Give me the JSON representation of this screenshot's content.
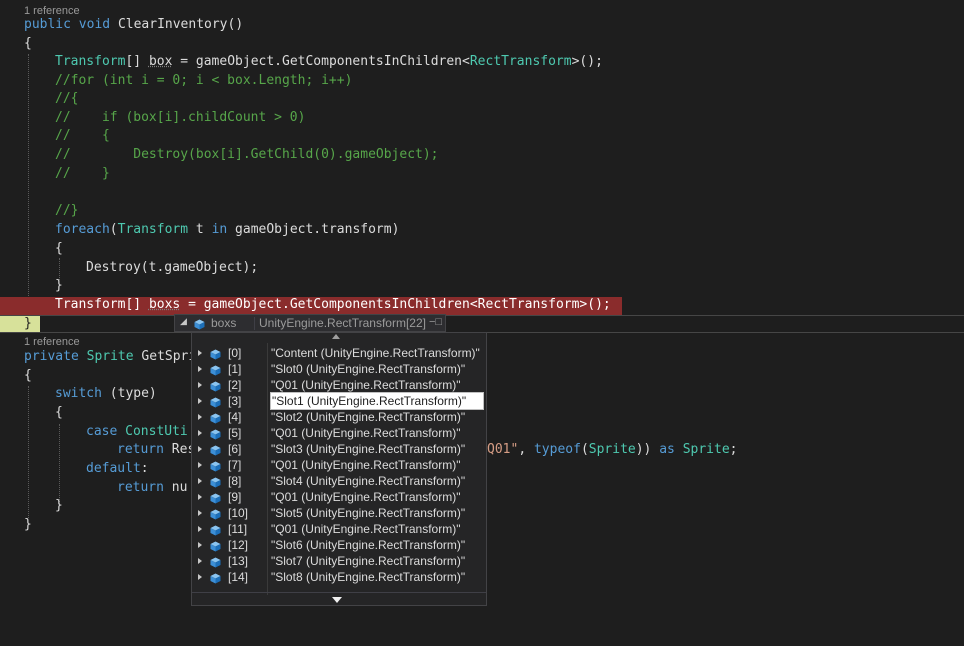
{
  "code": {
    "ref1": "1 reference",
    "ref2": "1 reference",
    "l1": {
      "kw1": "public",
      "kw2": "void",
      "name": "ClearInventory()"
    },
    "l2": "{",
    "l3": {
      "ty1": "Transform",
      "p1": "[] ",
      "box": "box",
      "p2": " = gameObject.GetComponentsInChildren<",
      "ty2": "RectTransform",
      "p3": ">();"
    },
    "l4": "//for (int i = 0; i < box.Length; i++)",
    "l5": "//{",
    "l6": "//    if (box[i].childCount > 0)",
    "l7": "//    {",
    "l8": "//        Destroy(box[i].GetChild(0).gameObject);",
    "l9": "//    }",
    "l10": "//}",
    "l11": {
      "kw1": "foreach",
      "p1": "(",
      "ty1": "Transform",
      "p2": " t ",
      "kw2": "in",
      "p3": " gameObject.transform)"
    },
    "l12": "{",
    "l13": "Destroy(t.gameObject);",
    "l14": "}",
    "l15": {
      "ty1": "Transform",
      "p1": "[] ",
      "boxs": "boxs",
      "p2": " = gameObject.GetComponentsInChildren<",
      "ty2": "RectTransform",
      "p3": ">();"
    },
    "l16": "}",
    "l17": {
      "kw1": "private",
      "ty1": "Sprite",
      "name": "GetSpri"
    },
    "l18": "{",
    "l19": {
      "kw1": "switch",
      "p1": " (type)"
    },
    "l20": "{",
    "l21": {
      "kw1": "case",
      "p1": "ConstUti"
    },
    "l22": {
      "kw1": "return",
      "p1": "Res",
      "st1": "Q01\"",
      "p2": ", ",
      "kw2": "typeof",
      "p3": "(",
      "ty1": "Sprite",
      "p4": ")) ",
      "kw3": "as",
      "p5": " ",
      "ty2": "Sprite",
      "p6": ";"
    },
    "l23": {
      "kw1": "default",
      "p1": ":"
    },
    "l24": {
      "kw1": "return",
      "p1": "nu"
    },
    "l25": "}",
    "l26": "}"
  },
  "datatip": {
    "name": "boxs",
    "value": "UnityEngine.RectTransform[22]",
    "rows": [
      {
        "index": "[0]",
        "value": "\"Content (UnityEngine.RectTransform)\""
      },
      {
        "index": "[1]",
        "value": "\"Slot0 (UnityEngine.RectTransform)\""
      },
      {
        "index": "[2]",
        "value": "\"Q01 (UnityEngine.RectTransform)\""
      },
      {
        "index": "[3]",
        "value": "\"Slot1 (UnityEngine.RectTransform)\""
      },
      {
        "index": "[4]",
        "value": "\"Slot2 (UnityEngine.RectTransform)\""
      },
      {
        "index": "[5]",
        "value": "\"Q01 (UnityEngine.RectTransform)\""
      },
      {
        "index": "[6]",
        "value": "\"Slot3 (UnityEngine.RectTransform)\""
      },
      {
        "index": "[7]",
        "value": "\"Q01 (UnityEngine.RectTransform)\""
      },
      {
        "index": "[8]",
        "value": "\"Slot4 (UnityEngine.RectTransform)\""
      },
      {
        "index": "[9]",
        "value": "\"Q01 (UnityEngine.RectTransform)\""
      },
      {
        "index": "[10]",
        "value": "\"Slot5 (UnityEngine.RectTransform)\""
      },
      {
        "index": "[11]",
        "value": "\"Q01 (UnityEngine.RectTransform)\""
      },
      {
        "index": "[12]",
        "value": "\"Slot6 (UnityEngine.RectTransform)\""
      },
      {
        "index": "[13]",
        "value": "\"Slot7 (UnityEngine.RectTransform)\""
      },
      {
        "index": "[14]",
        "value": "\"Slot8 (UnityEngine.RectTransform)\""
      }
    ],
    "selected_index": 3
  },
  "icons": {
    "expand": "expand-arrow-icon",
    "object": "object-cube-icon",
    "pin": "pin-icon",
    "scroll_up": "scroll-up-icon",
    "scroll_down": "scroll-down-icon"
  },
  "colors": {
    "keyword": "#569cd6",
    "type": "#4ec9b0",
    "comment": "#57a64a",
    "string": "#d69d85",
    "breakpoint_line": "#8a2c2c",
    "current_brace_highlight": "#d7e19a"
  }
}
